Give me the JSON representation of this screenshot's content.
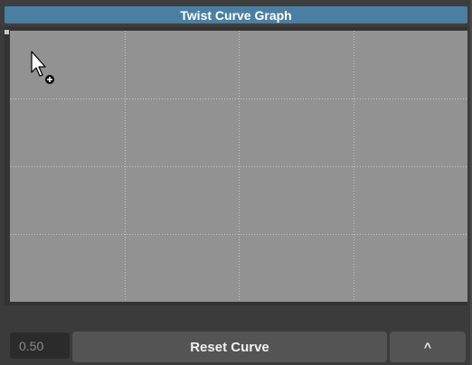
{
  "window": {
    "title": "Twist Curve Graph"
  },
  "graph": {
    "grid_columns": 4,
    "grid_rows": 4,
    "background_color": "#929292",
    "grid_line_color": "#c4c4c4"
  },
  "cursor": {
    "icon": "arrow-cursor-add-icon"
  },
  "controls": {
    "value": "0.50",
    "reset_label": "Reset Curve",
    "expand_label": "^"
  },
  "colors": {
    "title_accent": "#4a7fa1",
    "button_bg": "#545454",
    "panel_bg": "#3b3b3b"
  }
}
